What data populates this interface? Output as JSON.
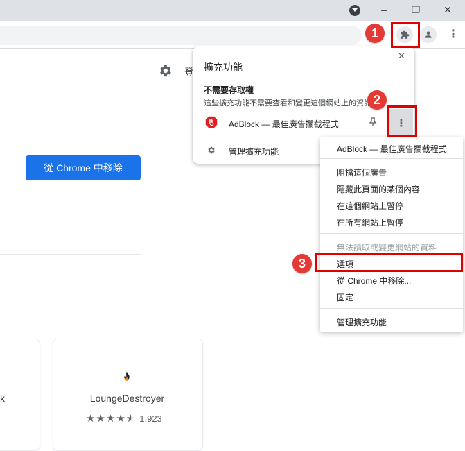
{
  "browser": {
    "window_controls": {
      "minimize": "–",
      "restore": "❐",
      "close": "✕"
    },
    "toolbar": {
      "menu_dots": "⋮"
    }
  },
  "page": {
    "header_text": "登",
    "remove_button": "從 Chrome 中移除",
    "card": {
      "name": "LoungeDestroyer",
      "rating_count": "1,923",
      "left_partial_text": "k",
      "stars": 4.5
    }
  },
  "extensions_popup": {
    "title": "擴充功能",
    "close": "✕",
    "section_title": "不需要存取權",
    "section_desc": "這些擴充功能不需要查看和變更這個網站上的資訊",
    "extension_name": "AdBlock — 最佳廣告攔截程式",
    "manage_label": "管理擴充功能",
    "more_dots": "⋮"
  },
  "context_menu": {
    "header": "AdBlock — 最佳廣告攔截程式",
    "items_group1": [
      "阻擋這個廣告",
      "隱藏此頁面的某個內容",
      "在這個網站上暫停",
      "在所有網站上暫停"
    ],
    "disabled_item": "無法讀取或變更網站的資料",
    "items_group2": [
      "選項",
      "從 Chrome 中移除...",
      "固定"
    ],
    "manage": "管理擴充功能"
  },
  "annotations": {
    "step1": "1",
    "step2": "2",
    "step3": "3"
  },
  "colors": {
    "accent": "#1a73e8",
    "annotation": "#e00000",
    "adblock_red": "#e02020"
  }
}
